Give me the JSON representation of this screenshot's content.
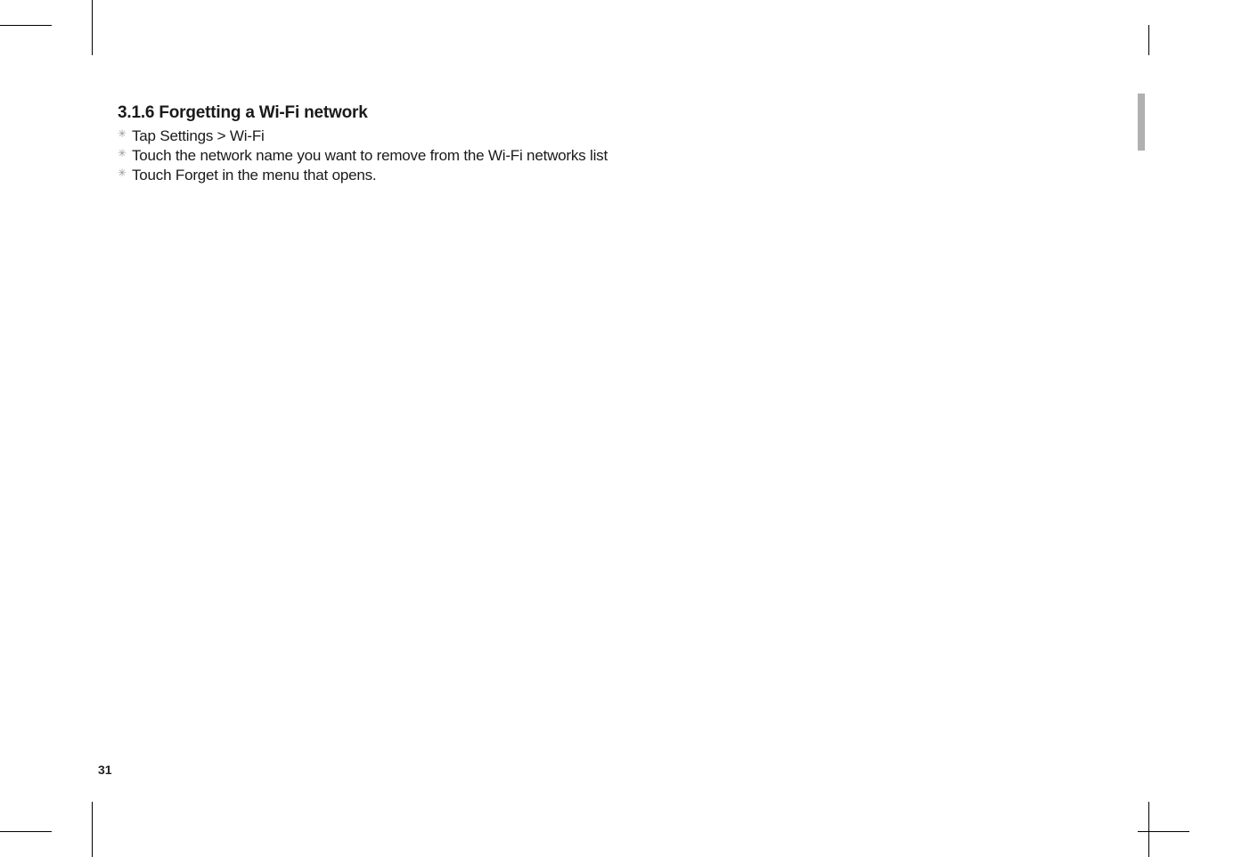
{
  "heading": "3.1.6 Forgetting a Wi-Fi network",
  "steps": [
    "Tap Settings > Wi-Fi",
    "Touch the network name you want to remove from the Wi-Fi networks list",
    "Touch Forget in the menu that opens."
  ],
  "page_number": "31"
}
